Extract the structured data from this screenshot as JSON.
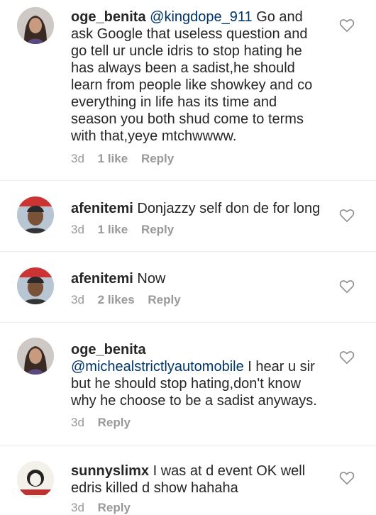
{
  "heart_icon": "heart-outline-icon",
  "comments": [
    {
      "username": "oge_benita",
      "mention": "@kingdope_911",
      "body": " Go and ask Google that useless question and go tell ur uncle idris to stop hating he has always been a sadist,he should learn from people like showkey and co everything in life has its time and season you both shud come to terms with that,yeye mtchwwww.",
      "time": "3d",
      "likes": "1 like",
      "reply": "Reply"
    },
    {
      "username": "afenitemi",
      "mention": "",
      "body": " Donjazzy self don de for long",
      "time": "3d",
      "likes": "1 like",
      "reply": "Reply"
    },
    {
      "username": "afenitemi",
      "mention": "",
      "body": " Now",
      "time": "3d",
      "likes": "2 likes",
      "reply": "Reply"
    },
    {
      "username": "oge_benita",
      "mention": "@michealstrictlyautomobile",
      "body": " I hear u sir but he should stop hating,don't know why he choose to be a sadist anyways.",
      "time": "3d",
      "likes": "",
      "reply": "Reply"
    },
    {
      "username": "sunnyslimx",
      "mention": "",
      "body": " I was at d event OK well edris killed d show hahaha",
      "time": "3d",
      "likes": "",
      "reply": "Reply"
    }
  ]
}
